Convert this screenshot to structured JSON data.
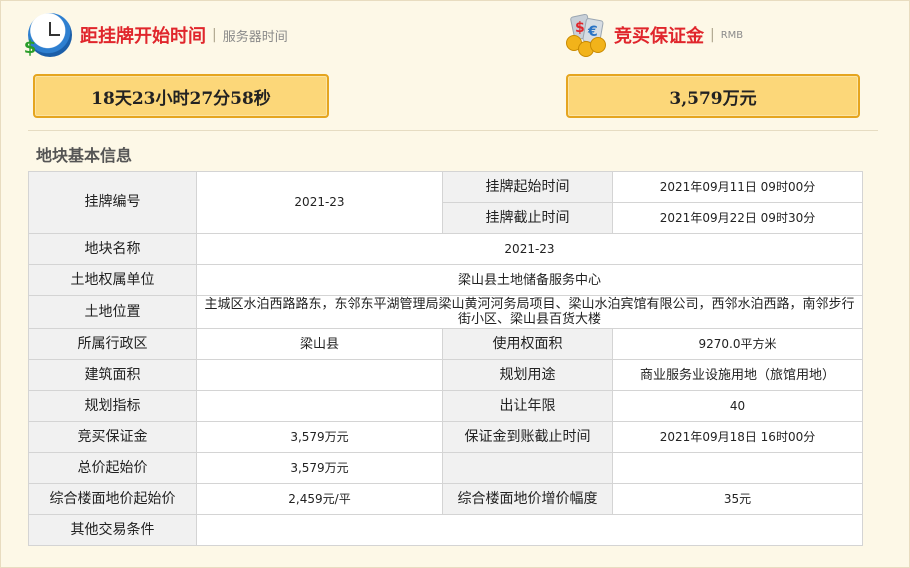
{
  "header": {
    "countdown": {
      "icon": "clock-dollar-icon",
      "title": "距挂牌开始时间",
      "subtitle": "服务器时间",
      "value": "18天23小时27分58秒"
    },
    "deposit": {
      "icon": "money-icon",
      "title": "竞买保证金",
      "subtitle": "RMB",
      "value": "3,579万元"
    }
  },
  "section_title": "地块基本信息",
  "table": {
    "listing_no_label": "挂牌编号",
    "listing_no": "2021-23",
    "start_time_label": "挂牌起始时间",
    "start_time": "2021年09月11日 09时00分",
    "end_time_label": "挂牌截止时间",
    "end_time": "2021年09月22日 09时30分",
    "parcel_name_label": "地块名称",
    "parcel_name": "2021-23",
    "owner_label": "土地权属单位",
    "owner": "梁山县土地储备服务中心",
    "location_label": "土地位置",
    "location": "主城区水泊西路路东，东邻东平湖管理局梁山黄河河务局项目、梁山水泊宾馆有限公司，西邻水泊西路，南邻步行街小区、梁山县百货大楼",
    "district_label": "所属行政区",
    "district": "梁山县",
    "area_label": "使用权面积",
    "area": "9270.0平方米",
    "building_area_label": "建筑面积",
    "building_area": "",
    "planned_use_label": "规划用途",
    "planned_use": "商业服务业设施用地（旅馆用地）",
    "planning_index_label": "规划指标",
    "planning_index": "",
    "term_label": "出让年限",
    "term": "40",
    "deposit_label": "竞买保证金",
    "deposit": "3,579万元",
    "deposit_deadline_label": "保证金到账截止时间",
    "deposit_deadline": "2021年09月18日 16时00分",
    "total_start_price_label": "总价起始价",
    "total_start_price": "3,579万元",
    "blank_label": "",
    "blank_value": "",
    "floor_price_label": "综合楼面地价起始价",
    "floor_price": "2,459元/平",
    "floor_increment_label": "综合楼面地价增价幅度",
    "floor_increment": "35元",
    "other_conditions_label": "其他交易条件",
    "other_conditions": ""
  }
}
